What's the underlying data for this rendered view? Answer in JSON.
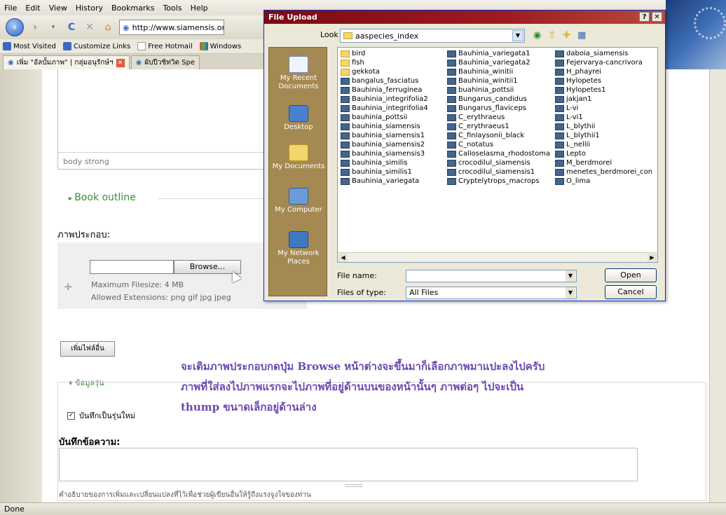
{
  "browser": {
    "menu": [
      "File",
      "Edit",
      "View",
      "History",
      "Bookmarks",
      "Tools",
      "Help"
    ],
    "url": "http://www.siamensis.org/no",
    "bookmarks": [
      "Most Visited",
      "Customize Links",
      "Free Hotmail",
      "Windows"
    ],
    "tabs": [
      "เพิ่ม \"อัลบั้มภาพ\" | กลุ่มอนุรักษ์ฯ",
      "ผับปีวชิทวิต Spe"
    ],
    "status": "Done"
  },
  "page": {
    "path_text": "body  strong",
    "book_outline": "Book outline",
    "attach_label": "ภาพประกอบ:",
    "browse_label": "Browse...",
    "max_size": "Maximum Filesize: 4 MB",
    "allowed_ext": "Allowed Extensions: png gif jpg jpeg",
    "add_file_button": "เพิ่มไฟล์อื่น",
    "annotation_lines": [
      "จะเติมภาพประกอบกดปุ่ม Browse หน้าต่างจะขึ้นมาก็เลือกภาพมาแปะลงไปครับ",
      "ภาพที่ใส่ลงไปภาพแรกจะไปภาพที่อยู่ด้านบนของหน้านั้นๆ ภาพต่อๆ ไปจะเป็น",
      "thump ขนาดเล็กอยู่ด้านล่าง"
    ],
    "version_legend": "ข้อมูลรุ่น",
    "new_revision": "บันทึกเป็นรุ่นใหม่",
    "log_label": "บันทึกข้อความ:",
    "log_desc": "คำอธิบายของการเพิ่มและเปลี่ยนแปลงที่ไว้เพื่อช่วยผู้เขียนอื่นให้รู้ถึงแรงจูงใจของท่าน"
  },
  "dialog": {
    "title": "File Upload",
    "look_in_label": "Look in:",
    "look_in_value": "aaspecies_index",
    "places": [
      "My Recent Documents",
      "Desktop",
      "My Documents",
      "My Computer",
      "My Network Places"
    ],
    "files": [
      [
        "bird",
        "fish",
        "gekkota",
        "bangalus_fasciatus",
        "Bauhinia_ferruginea",
        "Bauhinia_integrifolia2",
        "Bauhinia_integrifolia4",
        "bauhinia_pottsii",
        "bauhinia_siamensis",
        "bauhinia_siamensis1",
        "bauhinia_siamensis2",
        "bauhinia_siamensis3",
        "bauhinia_similis",
        "bauhinia_similis1",
        "Bauhinia_variegata"
      ],
      [
        "Bauhinia_variegata1",
        "Bauhinia_variegata2",
        "Bauhinia_winitii",
        "Bauhinia_winitii1",
        "buahinia_pottsii",
        "Bungarus_candidus",
        "Bungarus_flaviceps",
        "C_erythraeus",
        "C_erythraeus1",
        "C_finlaysonii_black",
        "C_notatus",
        "Calloselasma_rhodostoma",
        "crocodilul_siamensis",
        "crocodilul_siamensis1",
        "Cryptelytrops_macrops"
      ],
      [
        "daboia_siamensis",
        "Fejervarya-cancrivora",
        "H_phayrei",
        "Hylopetes",
        "Hylopetes1",
        "jakjan1",
        "L-vi",
        "L-vi1",
        "L_blythii",
        "L_blythii1",
        "L_nellii",
        "Lepto",
        "M_berdmorei",
        "menetes_berdmorei_con",
        "O_lima"
      ]
    ],
    "file_name_label": "File name:",
    "file_name_value": "",
    "files_of_type_label": "Files of type:",
    "files_of_type_value": "All Files",
    "open_button": "Open",
    "cancel_button": "Cancel"
  }
}
